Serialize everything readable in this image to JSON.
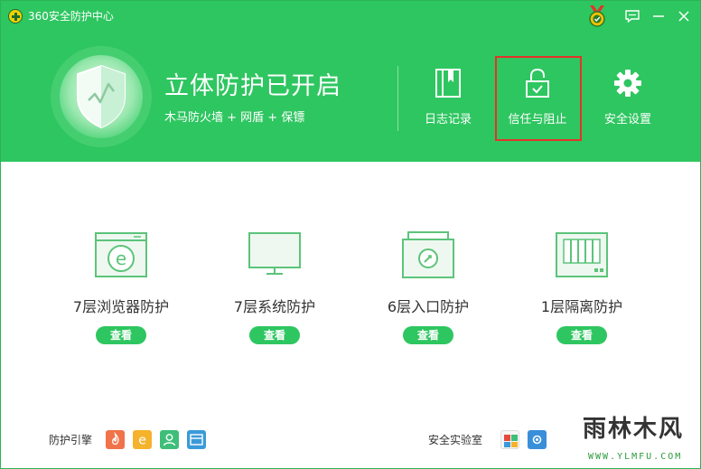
{
  "window": {
    "title": "360安全防护中心"
  },
  "header": {
    "title": "立体防护已开启",
    "subtitle": "木马防火墙 + 网盾 + 保镖"
  },
  "nav": {
    "log_label": "日志记录",
    "trust_label": "信任与阻止",
    "settings_label": "安全设置"
  },
  "cards": [
    {
      "label": "7层浏览器防护",
      "button": "查看",
      "icon": "browser-protection-icon"
    },
    {
      "label": "7层系统防护",
      "button": "查看",
      "icon": "monitor-protection-icon"
    },
    {
      "label": "6层入口防护",
      "button": "查看",
      "icon": "entry-protection-icon"
    },
    {
      "label": "1层隔离防护",
      "button": "查看",
      "icon": "isolation-protection-icon"
    }
  ],
  "footer": {
    "engine_label": "防护引擎",
    "lab_label": "安全实验室"
  },
  "watermark": {
    "text": "雨林木风",
    "url": "WWW.YLMFU.COM"
  },
  "colors": {
    "brand_green": "#2ec660",
    "highlight_red": "#e3332a"
  }
}
